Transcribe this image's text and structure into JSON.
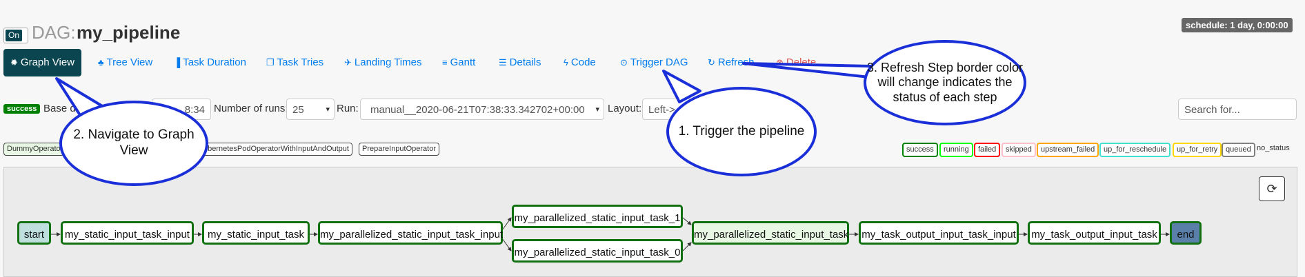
{
  "header": {
    "toggle_label": "On",
    "dag_prefix": "DAG:",
    "dag_name": "my_pipeline",
    "schedule": "schedule: 1 day, 0:00:00"
  },
  "nav": {
    "graph_view": "Graph View",
    "tree_view": "Tree View",
    "task_duration": "Task Duration",
    "task_tries": "Task Tries",
    "landing_times": "Landing Times",
    "gantt": "Gantt",
    "details": "Details",
    "code": "Code",
    "trigger_dag": "Trigger DAG",
    "refresh": "Refresh",
    "delete": "Delete"
  },
  "controls": {
    "status_badge": "success",
    "base_date_label": "Base da",
    "base_date_value": "8:34",
    "num_runs_label": "Number of runs:",
    "num_runs_value": "25",
    "run_label": "Run:",
    "run_value": "manual__2020-06-21T07:38:33.342702+00:00",
    "layout_label": "Layout:",
    "layout_value": "Left->",
    "search_placeholder": "Search for..."
  },
  "operators": {
    "dummy": "DummyOperato",
    "k8s": "ubernetesPodOperatorWithInputAndOutput",
    "prepare": "PrepareInputOperator"
  },
  "legend": {
    "success": "success",
    "running": "running",
    "failed": "failed",
    "skipped": "skipped",
    "upstream_failed": "upstream_failed",
    "up_for_reschedule": "up_for_reschedule",
    "up_for_retry": "up_for_retry",
    "queued": "queued",
    "no_status": "no_status"
  },
  "legend_colors": {
    "success": "#008000",
    "running": "#00ff00",
    "failed": "#ff0000",
    "skipped": "#ffc0cb",
    "upstream_failed": "#ffa500",
    "up_for_reschedule": "#40e0d0",
    "up_for_retry": "#ffd700",
    "queued": "#808080"
  },
  "nodes": {
    "start": "start",
    "static_input_task_input": "my_static_input_task_input",
    "static_input_task": "my_static_input_task",
    "par_static_input_task_input": "my_parallelized_static_input_task_input",
    "par_task_1": "my_parallelized_static_input_task_1",
    "par_task_0": "my_parallelized_static_input_task_0",
    "par_static_input_task": "my_parallelized_static_input_task",
    "task_output_input_task_input": "my_task_output_input_task_input",
    "task_output_input_task": "my_task_output_input_task",
    "end": "end"
  },
  "callouts": {
    "navigate": "2. Navigate to Graph View",
    "trigger": "1. Trigger the pipeline",
    "refresh": "3. Refresh Step border color will change indicates the status of each step"
  },
  "colors": {
    "accent": "#0b4550",
    "link": "#017cee",
    "callout_border": "#1a2fd8"
  }
}
